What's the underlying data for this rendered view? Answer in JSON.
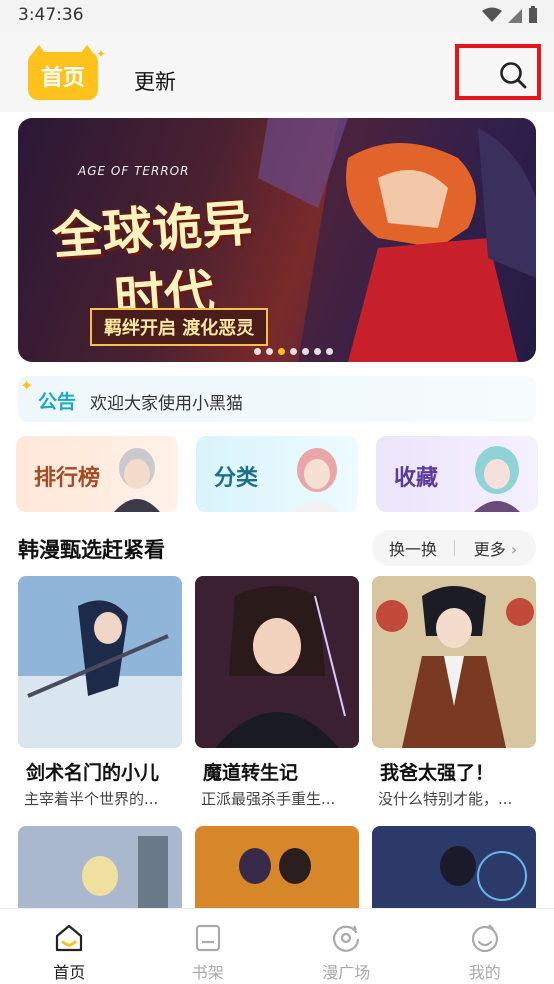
{
  "status_bar": {
    "time": "3:47:36"
  },
  "header": {
    "tab_home": "首页",
    "tab_update": "更新",
    "search_icon": "search-icon"
  },
  "banner": {
    "subtitle": "AGE OF TERROR",
    "title_line1": "全球诡异",
    "title_line2": "时代",
    "tagline": "羁绊开启 渡化恶灵",
    "dots": 7,
    "active_dot": 3
  },
  "notice": {
    "title": "公告",
    "text": "欢迎大家使用小黑猫"
  },
  "categories": [
    {
      "label": "排行榜"
    },
    {
      "label": "分类"
    },
    {
      "label": "收藏"
    }
  ],
  "section": {
    "title": "韩漫甄选赶紧看",
    "refresh": "换一换",
    "more": "更多"
  },
  "comics": [
    {
      "title": "剑术名门的小儿",
      "desc": "主宰着半个世界的..."
    },
    {
      "title": "魔道转生记",
      "desc": "正派最强杀手重生..."
    },
    {
      "title": "我爸太强了！",
      "desc": "没什么特别才能，..."
    }
  ],
  "bottom_nav": [
    {
      "label": "首页",
      "icon": "home-icon",
      "active": true
    },
    {
      "label": "书架",
      "icon": "bookshelf-icon",
      "active": false
    },
    {
      "label": "漫广场",
      "icon": "discover-icon",
      "active": false
    },
    {
      "label": "我的",
      "icon": "profile-icon",
      "active": false
    }
  ],
  "colors": {
    "accent": "#ffc21d",
    "highlight": "#e8131d",
    "notice": "#19a8c9"
  }
}
